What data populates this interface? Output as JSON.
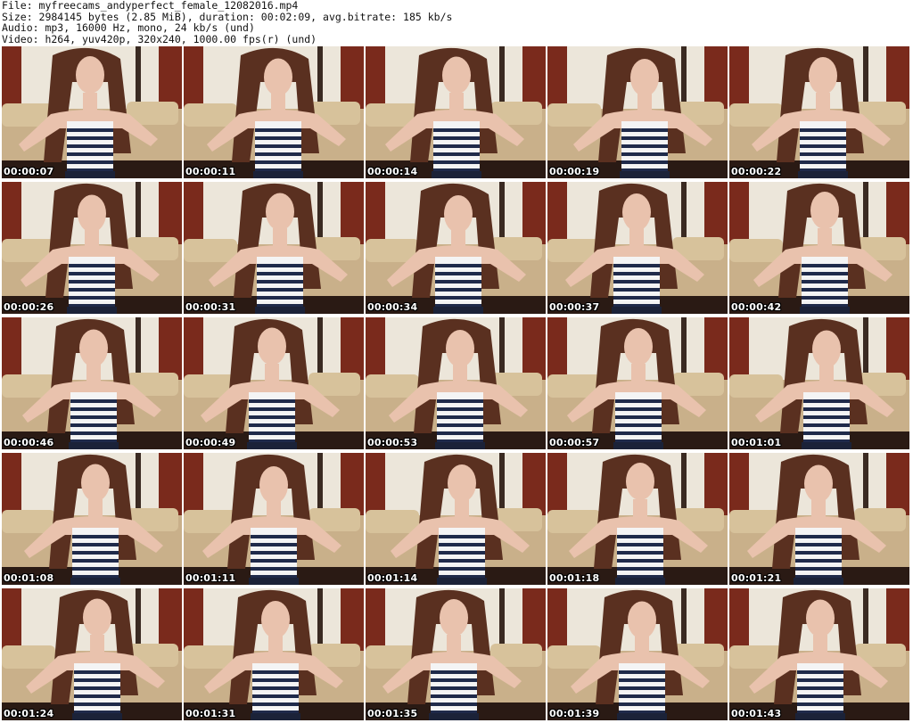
{
  "header": {
    "file_line": "File: myfreecams_andyperfect_female_12082016.mp4",
    "size_line": "Size: 2984145 bytes (2.85 MiB), duration: 00:02:09, avg.bitrate: 185 kb/s",
    "audio_line": "Audio: mp3, 16000 Hz, mono, 24 kb/s (und)",
    "video_line": "Video: h264, yuv420p, 320x240, 1000.00 fps(r) (und)"
  },
  "thumbnails": [
    {
      "timestamp": "00:00:07"
    },
    {
      "timestamp": "00:00:11"
    },
    {
      "timestamp": "00:00:14"
    },
    {
      "timestamp": "00:00:19"
    },
    {
      "timestamp": "00:00:22"
    },
    {
      "timestamp": "00:00:26"
    },
    {
      "timestamp": "00:00:31"
    },
    {
      "timestamp": "00:00:34"
    },
    {
      "timestamp": "00:00:37"
    },
    {
      "timestamp": "00:00:42"
    },
    {
      "timestamp": "00:00:46"
    },
    {
      "timestamp": "00:00:49"
    },
    {
      "timestamp": "00:00:53"
    },
    {
      "timestamp": "00:00:57"
    },
    {
      "timestamp": "00:01:01"
    },
    {
      "timestamp": "00:01:08"
    },
    {
      "timestamp": "00:01:11"
    },
    {
      "timestamp": "00:01:14"
    },
    {
      "timestamp": "00:01:18"
    },
    {
      "timestamp": "00:01:21"
    },
    {
      "timestamp": "00:01:24"
    },
    {
      "timestamp": "00:01:31"
    },
    {
      "timestamp": "00:01:35"
    },
    {
      "timestamp": "00:01:39"
    },
    {
      "timestamp": "00:01:43"
    }
  ],
  "colors": {
    "wall": "#ece6da",
    "curtain": "#7a2a1c",
    "sofa": "#c9b08a",
    "hair": "#5a3020",
    "skin": "#e9c2ad",
    "stripe_dark": "#1f2a4a",
    "stripe_light": "#f4f4f4",
    "skirt": "#1b2238"
  }
}
